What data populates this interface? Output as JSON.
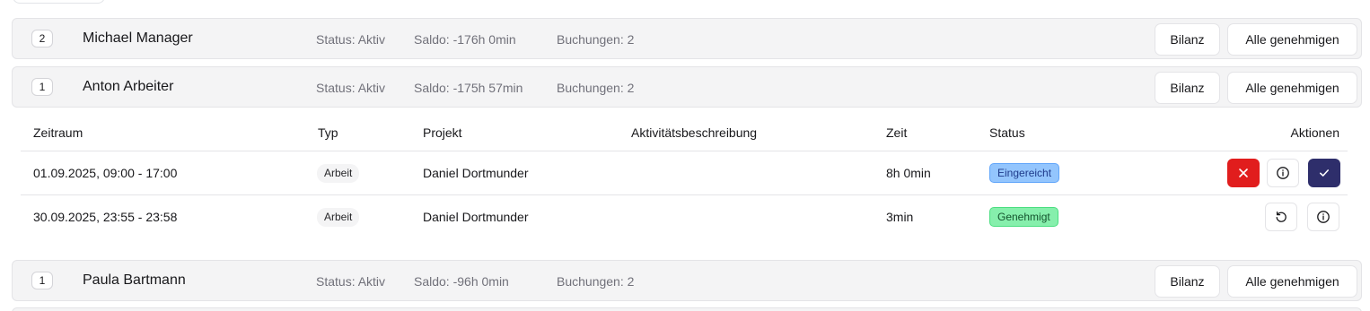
{
  "employees": [
    {
      "count": "2",
      "name": "Michael Manager",
      "status": "Status: Aktiv",
      "saldo": "Saldo: -176h 0min",
      "bookings": "Buchungen: 2",
      "bilanz_label": "Bilanz",
      "approve_all_label": "Alle genehmigen"
    },
    {
      "count": "1",
      "name": "Anton Arbeiter",
      "status": "Status: Aktiv",
      "saldo": "Saldo: -175h 57min",
      "bookings": "Buchungen: 2",
      "bilanz_label": "Bilanz",
      "approve_all_label": "Alle genehmigen"
    },
    {
      "count": "1",
      "name": "Paula Bartmann",
      "status": "Status: Aktiv",
      "saldo": "Saldo: -96h 0min",
      "bookings": "Buchungen: 2",
      "bilanz_label": "Bilanz",
      "approve_all_label": "Alle genehmigen"
    }
  ],
  "table": {
    "headers": {
      "zeitraum": "Zeitraum",
      "typ": "Typ",
      "projekt": "Projekt",
      "beschreibung": "Aktivitätsbeschreibung",
      "zeit": "Zeit",
      "status": "Status",
      "aktionen": "Aktionen"
    },
    "rows": [
      {
        "zeitraum": "01.09.2025, 09:00 - 17:00",
        "typ": "Arbeit",
        "projekt": "Daniel Dortmunder",
        "beschreibung": "",
        "zeit": "8h 0min",
        "status": "Eingereicht",
        "status_color": "#93c5fd",
        "actions": [
          "reject-icon",
          "info-icon",
          "approve-icon"
        ]
      },
      {
        "zeitraum": "30.09.2025, 23:55 - 23:58",
        "typ": "Arbeit",
        "projekt": "Daniel Dortmunder",
        "beschreibung": "",
        "zeit": "3min",
        "status": "Genehmigt",
        "status_color": "#86efac",
        "actions": [
          "undo-icon",
          "info-icon"
        ]
      }
    ]
  },
  "colors": {
    "reject": "#e11d1d",
    "approve": "#2e2e6b"
  }
}
